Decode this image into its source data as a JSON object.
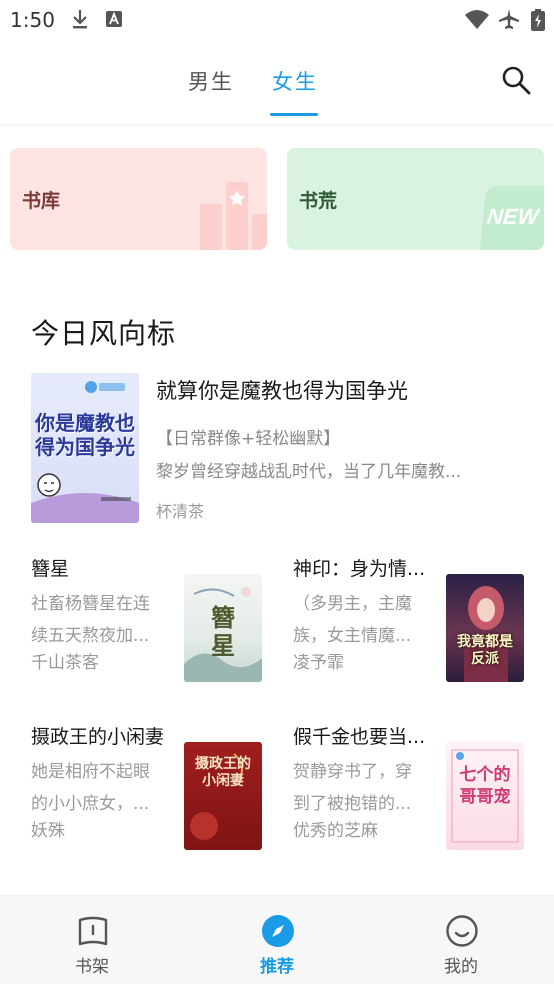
{
  "status_bar": {
    "time": "1:50"
  },
  "tabs": [
    {
      "label": "男生",
      "active": false
    },
    {
      "label": "女生",
      "active": true
    }
  ],
  "colors": {
    "accent": "#1a9be6",
    "card_library_bg": "#fde4e3",
    "card_shortage_bg": "#daf3e0"
  },
  "feature_cards": [
    {
      "label": "书库"
    },
    {
      "label": "书荒",
      "badge": "NEW"
    }
  ],
  "section": {
    "title": "今日风向标"
  },
  "featured_book": {
    "title": "就算你是魔教也得为国争光",
    "tags": "【日常群像+轻松幽默】",
    "description": "黎岁曾经穿越战乱时代，当了几年魔教...",
    "author": "杯清茶",
    "cover_text": "你是魔教也得为国争光"
  },
  "books": [
    {
      "title": "簪星",
      "description": "社畜杨簪星在连续五天熬夜加...",
      "author": "千山茶客",
      "cover_text": "簪星"
    },
    {
      "title": "神印：身为情...",
      "description": "（多男主，主魔族，女主情魔...",
      "author": "凌予霏",
      "cover_text": "我竟都是反派"
    },
    {
      "title": "摄政王的小闲妻",
      "description": "她是相府不起眼的小小庶女，...",
      "author": "妖殊",
      "cover_text": "摄政王的小闲妻"
    },
    {
      "title": "假千金也要当...",
      "description": "贺静穿书了，穿到了被抱错的...",
      "author": "优秀的芝麻",
      "cover_text": "七个的哥哥宠"
    }
  ],
  "bottom_nav": [
    {
      "label": "书架",
      "icon": "bookshelf-icon",
      "active": false
    },
    {
      "label": "推荐",
      "icon": "compass-icon",
      "active": true
    },
    {
      "label": "我的",
      "icon": "smiley-icon",
      "active": false
    }
  ]
}
